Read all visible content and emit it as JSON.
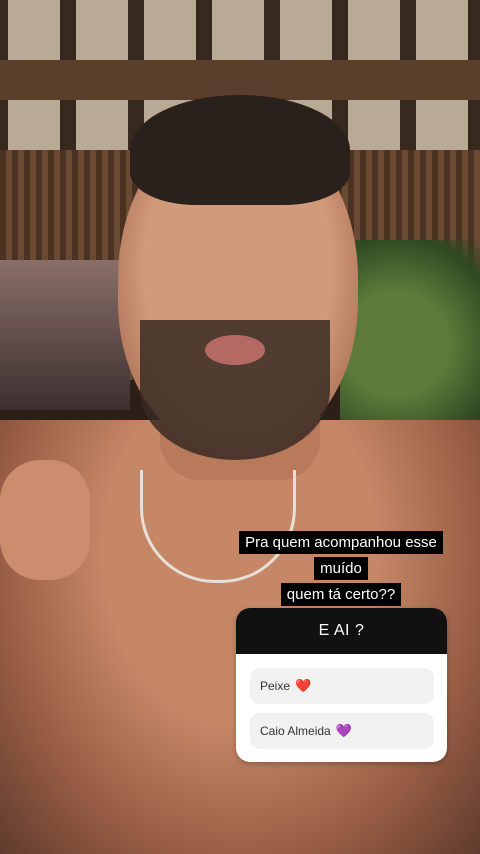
{
  "story": {
    "caption_lines": [
      "Pra quem acompanhou esse muído",
      "quem tá certo??"
    ]
  },
  "poll": {
    "question": "E AI ?",
    "options": [
      {
        "label": "Peixe",
        "emoji": "❤️"
      },
      {
        "label": "Caio Almeida",
        "emoji": "💜"
      }
    ]
  }
}
